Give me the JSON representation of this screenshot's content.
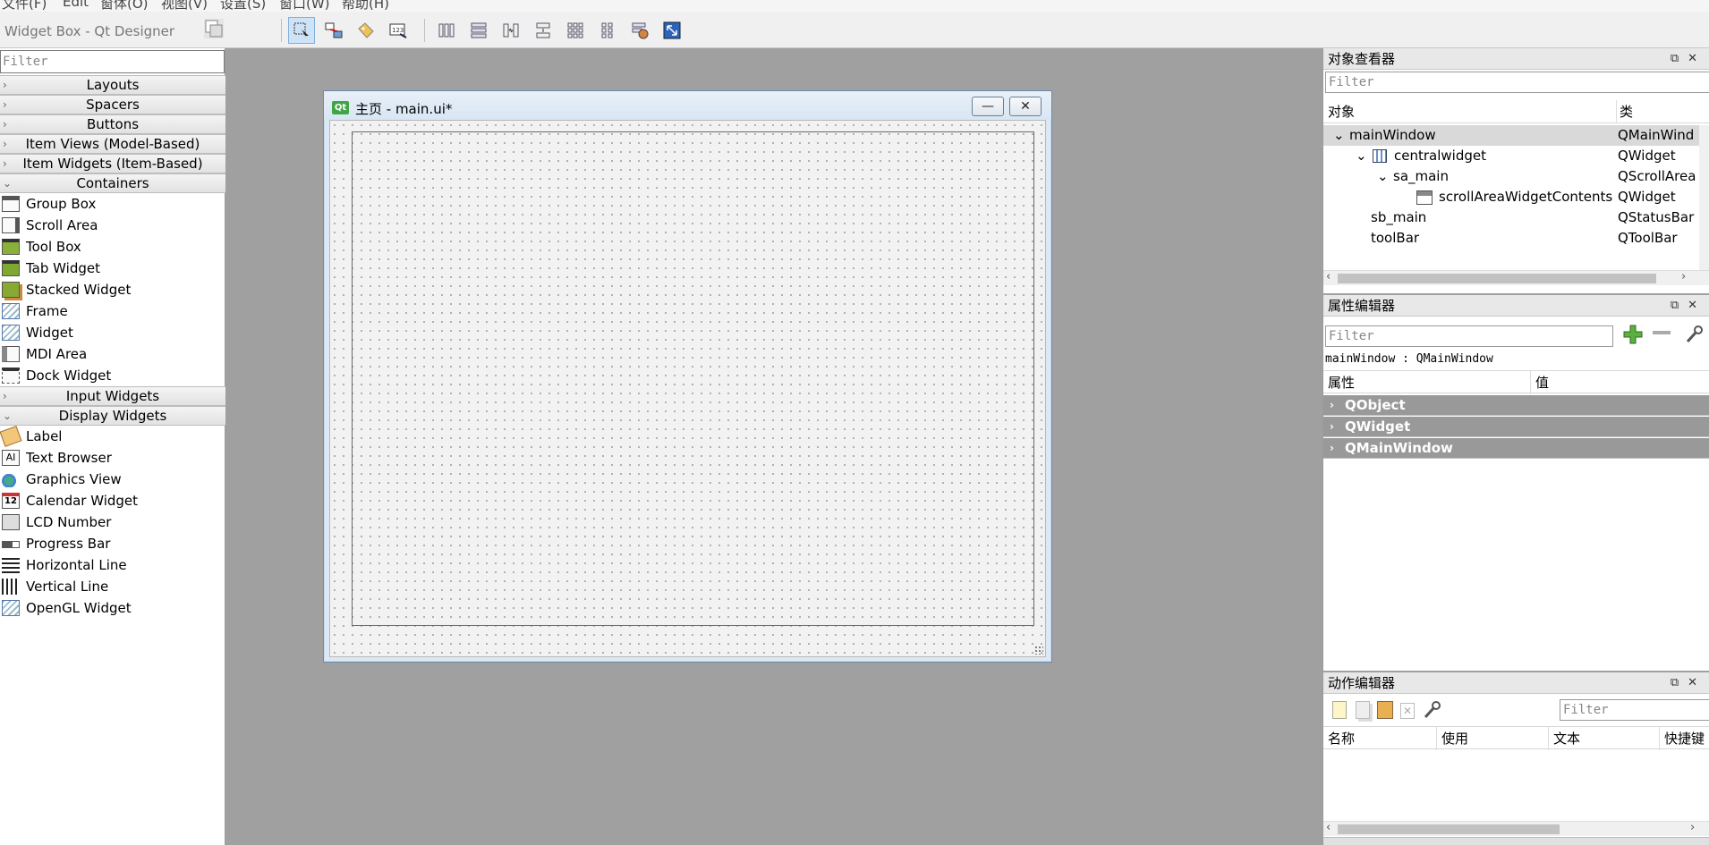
{
  "menubar": {
    "items": [
      "文件(F)",
      "Edit",
      "窗体(O)",
      "视图(V)",
      "设置(S)",
      "窗口(W)",
      "帮助(H)"
    ]
  },
  "toolbar": {
    "title": "Widget Box - Qt Designer"
  },
  "widget_box": {
    "filter_placeholder": "Filter",
    "categories": {
      "layouts": "Layouts",
      "spacers": "Spacers",
      "buttons": "Buttons",
      "item_views": "Item Views (Model-Based)",
      "item_widgets": "Item Widgets (Item-Based)",
      "containers": "Containers",
      "input_widgets": "Input Widgets",
      "display_widgets": "Display Widgets"
    },
    "containers_items": [
      "Group Box",
      "Scroll Area",
      "Tool Box",
      "Tab Widget",
      "Stacked Widget",
      "Frame",
      "Widget",
      "MDI Area",
      "Dock Widget"
    ],
    "display_items": [
      "Label",
      "Text Browser",
      "Graphics View",
      "Calendar Widget",
      "LCD Number",
      "Progress Bar",
      "Horizontal Line",
      "Vertical Line",
      "OpenGL Widget"
    ],
    "calendar_icon_text": "12"
  },
  "form_window": {
    "qt_badge": "Qt",
    "title": "主页 - main.ui*"
  },
  "object_inspector": {
    "title": "对象查看器",
    "filter_placeholder": "Filter",
    "col_object": "对象",
    "col_class": "类",
    "rows": [
      {
        "name": "mainWindow",
        "cls": "QMainWind"
      },
      {
        "name": "centralwidget",
        "cls": "QWidget"
      },
      {
        "name": "sa_main",
        "cls": "QScrollArea"
      },
      {
        "name": "scrollAreaWidgetContents",
        "cls": "QWidget"
      },
      {
        "name": "sb_main",
        "cls": "QStatusBar"
      },
      {
        "name": "toolBar",
        "cls": "QToolBar"
      }
    ]
  },
  "property_editor": {
    "title": "属性编辑器",
    "filter_placeholder": "Filter",
    "context": "mainWindow : QMainWindow",
    "col_property": "属性",
    "col_value": "值",
    "groups": [
      "QObject",
      "QWidget",
      "QMainWindow"
    ]
  },
  "action_editor": {
    "title": "动作编辑器",
    "filter_placeholder": "Filter",
    "columns": [
      "名称",
      "使用",
      "文本",
      "快捷键"
    ]
  },
  "colors": {
    "group_header": "#999999",
    "mdi_background": "#a0a0a0",
    "selected_row": "#d9d9d9"
  }
}
